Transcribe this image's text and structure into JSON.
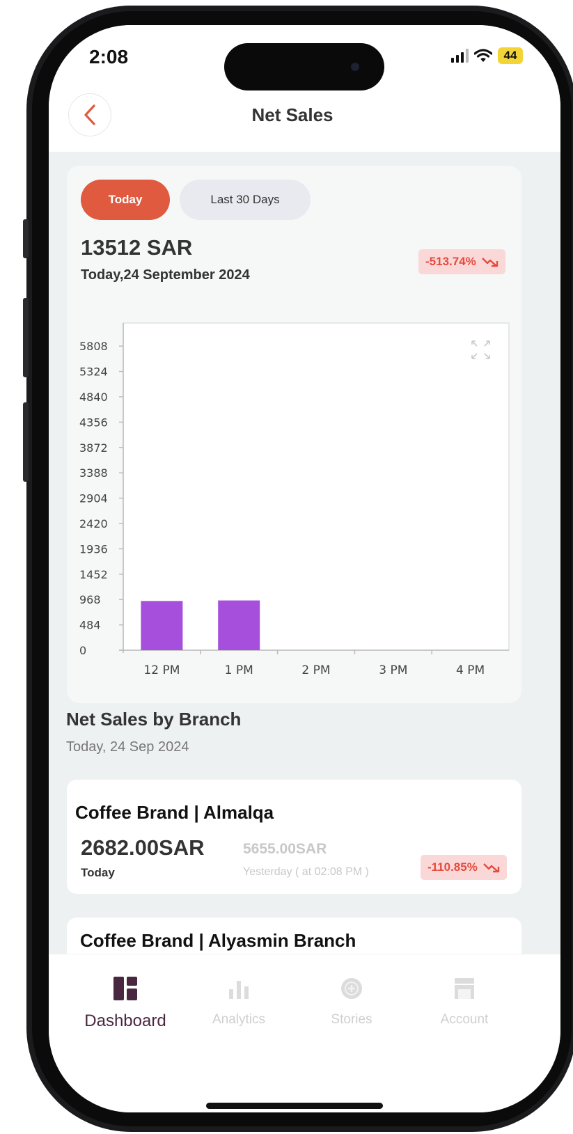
{
  "status_bar": {
    "time": "2:08",
    "battery": "44"
  },
  "header": {
    "title": "Net Sales"
  },
  "filters": {
    "today": "Today",
    "last_30": "Last 30 Days"
  },
  "summary": {
    "total": "13512 SAR",
    "date": "Today,24 September 2024",
    "change": "-513.74%"
  },
  "chart_data": {
    "type": "bar",
    "categories": [
      "12 PM",
      "1 PM",
      "2 PM",
      "3 PM",
      "4 PM"
    ],
    "values": [
      940,
      950,
      0,
      0,
      0
    ],
    "y_ticks": [
      "0",
      "484",
      "968",
      "1452",
      "1936",
      "2420",
      "2904",
      "3388",
      "3872",
      "4356",
      "4840",
      "5324",
      "5808"
    ],
    "ylim": [
      0,
      6200
    ],
    "bar_color": "#a64fdc",
    "grid": false
  },
  "branches_section": {
    "title": "Net Sales by Branch",
    "date": "Today, 24 Sep 2024"
  },
  "branches": [
    {
      "name": "Coffee Brand | Almalqa",
      "today_value": "2682.00SAR",
      "today_label": "Today",
      "yesterday_value": "5655.00SAR",
      "yesterday_label": "Yesterday ( at 02:08 PM )",
      "change": "-110.85%"
    },
    {
      "name": "Coffee Brand | Alyasmin Branch"
    }
  ],
  "bottom_nav": [
    {
      "label": "Dashboard",
      "icon": "dashboard-icon",
      "active": true
    },
    {
      "label": "Analytics",
      "icon": "analytics-icon",
      "active": false
    },
    {
      "label": "Stories",
      "icon": "stories-icon",
      "active": false
    },
    {
      "label": "Account",
      "icon": "account-icon",
      "active": false
    }
  ],
  "colors": {
    "accent": "#e05a40",
    "negative": "#e44b3e",
    "nav_active": "#4a2740"
  }
}
